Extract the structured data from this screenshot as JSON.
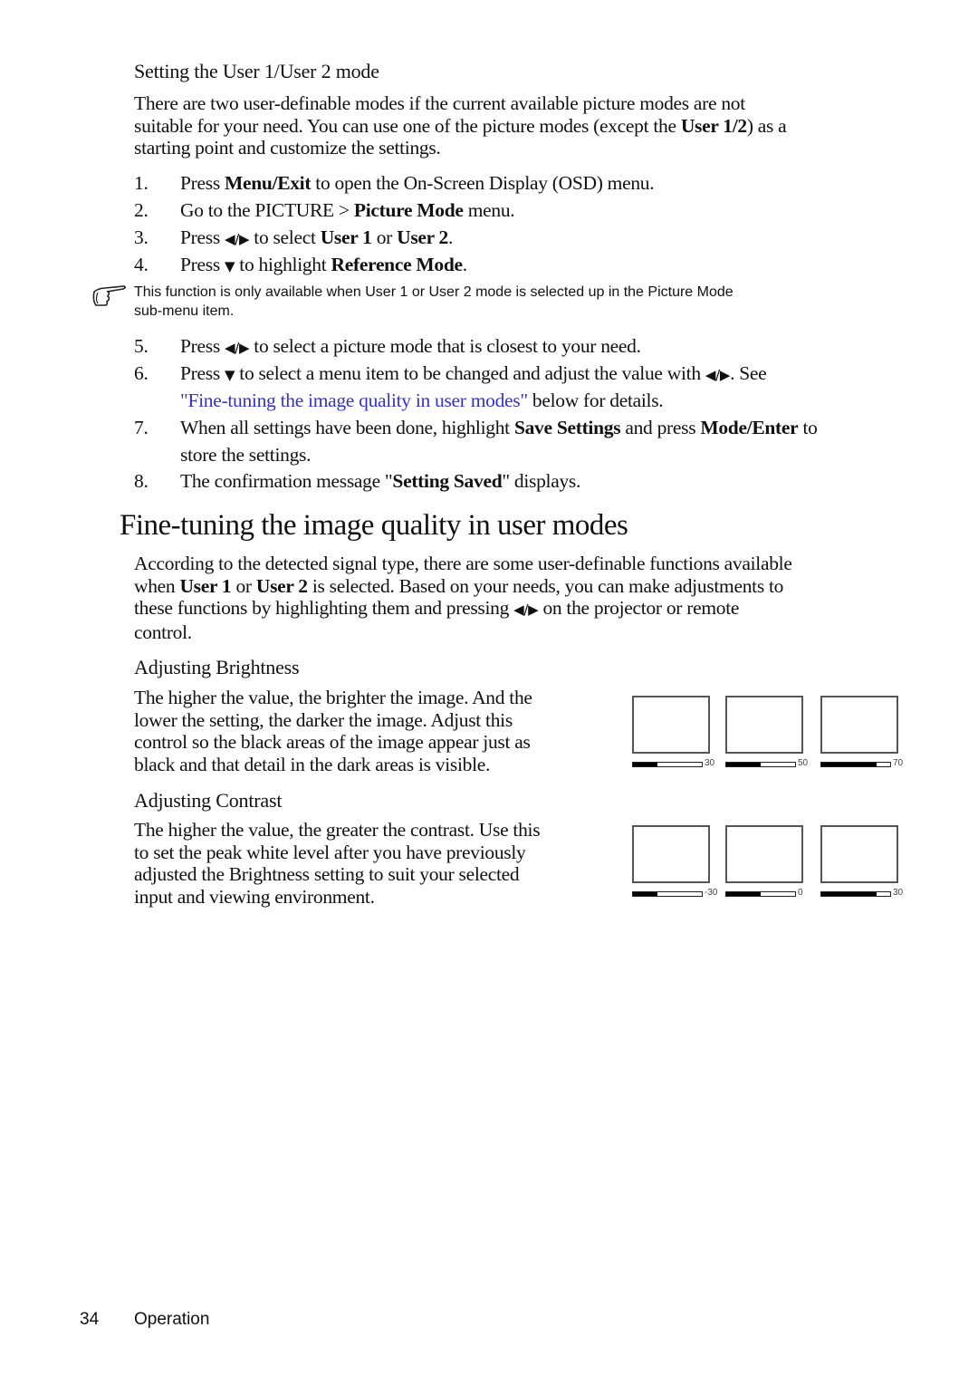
{
  "section_user_mode": {
    "heading": "Setting the User 1/User 2 mode",
    "intro_lines": [
      "There are two user-definable modes if the current available picture modes are not",
      "suitable for your need. You can use one of the picture modes (except the ",
      "User 1/2",
      ") as a",
      "starting point and customize the settings."
    ],
    "steps_a": [
      {
        "num": "1.",
        "parts": [
          "Press ",
          "Menu/Exit",
          " to open the On-Screen Display (OSD) menu."
        ]
      },
      {
        "num": "2.",
        "parts": [
          "Go to the PICTURE > ",
          "Picture Mode",
          " menu."
        ]
      },
      {
        "num": "3.",
        "parts": [
          "Press ",
          "◀/▶",
          " to select ",
          "User 1",
          " or ",
          "User 2",
          "."
        ]
      },
      {
        "num": "4.",
        "parts": [
          "Press ",
          "▼",
          " to highlight ",
          "Reference Mode",
          "."
        ]
      }
    ],
    "note_icon": "pointing-hand-icon",
    "note_lines": [
      "This function is only available when User 1 or User 2 mode is selected up in the Picture Mode",
      "sub-menu item."
    ],
    "steps_b": [
      {
        "num": "5.",
        "parts": [
          "Press ",
          "◀/▶",
          " to select a picture mode that is closest to your need."
        ]
      },
      {
        "num": "6.",
        "parts": [
          "Press ",
          "▼",
          " to select a menu item to be changed and adjust the value with ",
          "◀/▶",
          ". See"
        ],
        "cont": [
          "\"Fine-tuning the image quality in user modes\"",
          " below for details."
        ]
      },
      {
        "num": "7.",
        "parts": [
          "When all settings have been done, highlight ",
          "Save Settings",
          " and press ",
          "Mode/Enter",
          " to"
        ],
        "cont": [
          "store the settings."
        ]
      },
      {
        "num": "8.",
        "parts": [
          "The confirmation message \"",
          "Setting Saved",
          "\" displays."
        ]
      }
    ]
  },
  "section_fine_tuning": {
    "title": "Fine-tuning the image quality in user modes",
    "intro_lines": [
      "According to the detected signal type, there are some user-definable functions available",
      [
        "when ",
        "User 1",
        " or ",
        "User 2",
        " is selected. Based on your needs, you can make adjustments to"
      ],
      [
        "these functions by highlighting them and pressing ",
        "◀/▶",
        "  on the projector or remote"
      ],
      "control."
    ],
    "brightness": {
      "heading": "Adjusting Brightness",
      "lines": [
        "The higher the value, the brighter the image. And the",
        "lower the setting, the darker the image. Adjust this",
        "control so the black areas of the image appear just as",
        "black and that detail in the dark areas is visible."
      ],
      "samples": [
        {
          "label": "30",
          "fill_fraction": 0.35
        },
        {
          "label": "50",
          "fill_fraction": 0.5
        },
        {
          "label": "70",
          "fill_fraction": 0.8
        }
      ]
    },
    "contrast": {
      "heading": "Adjusting Contrast",
      "lines": [
        "The higher the value, the greater the contrast. Use this",
        "to set the peak white level after you have previously",
        "adjusted the Brightness setting to suit your selected",
        "input and viewing environment."
      ],
      "samples": [
        {
          "label": "-30",
          "fill_fraction": 0.35
        },
        {
          "label": "0",
          "fill_fraction": 0.5
        },
        {
          "label": "30",
          "fill_fraction": 0.8
        }
      ]
    }
  },
  "footer": {
    "page_number": "34",
    "section": "Operation"
  }
}
